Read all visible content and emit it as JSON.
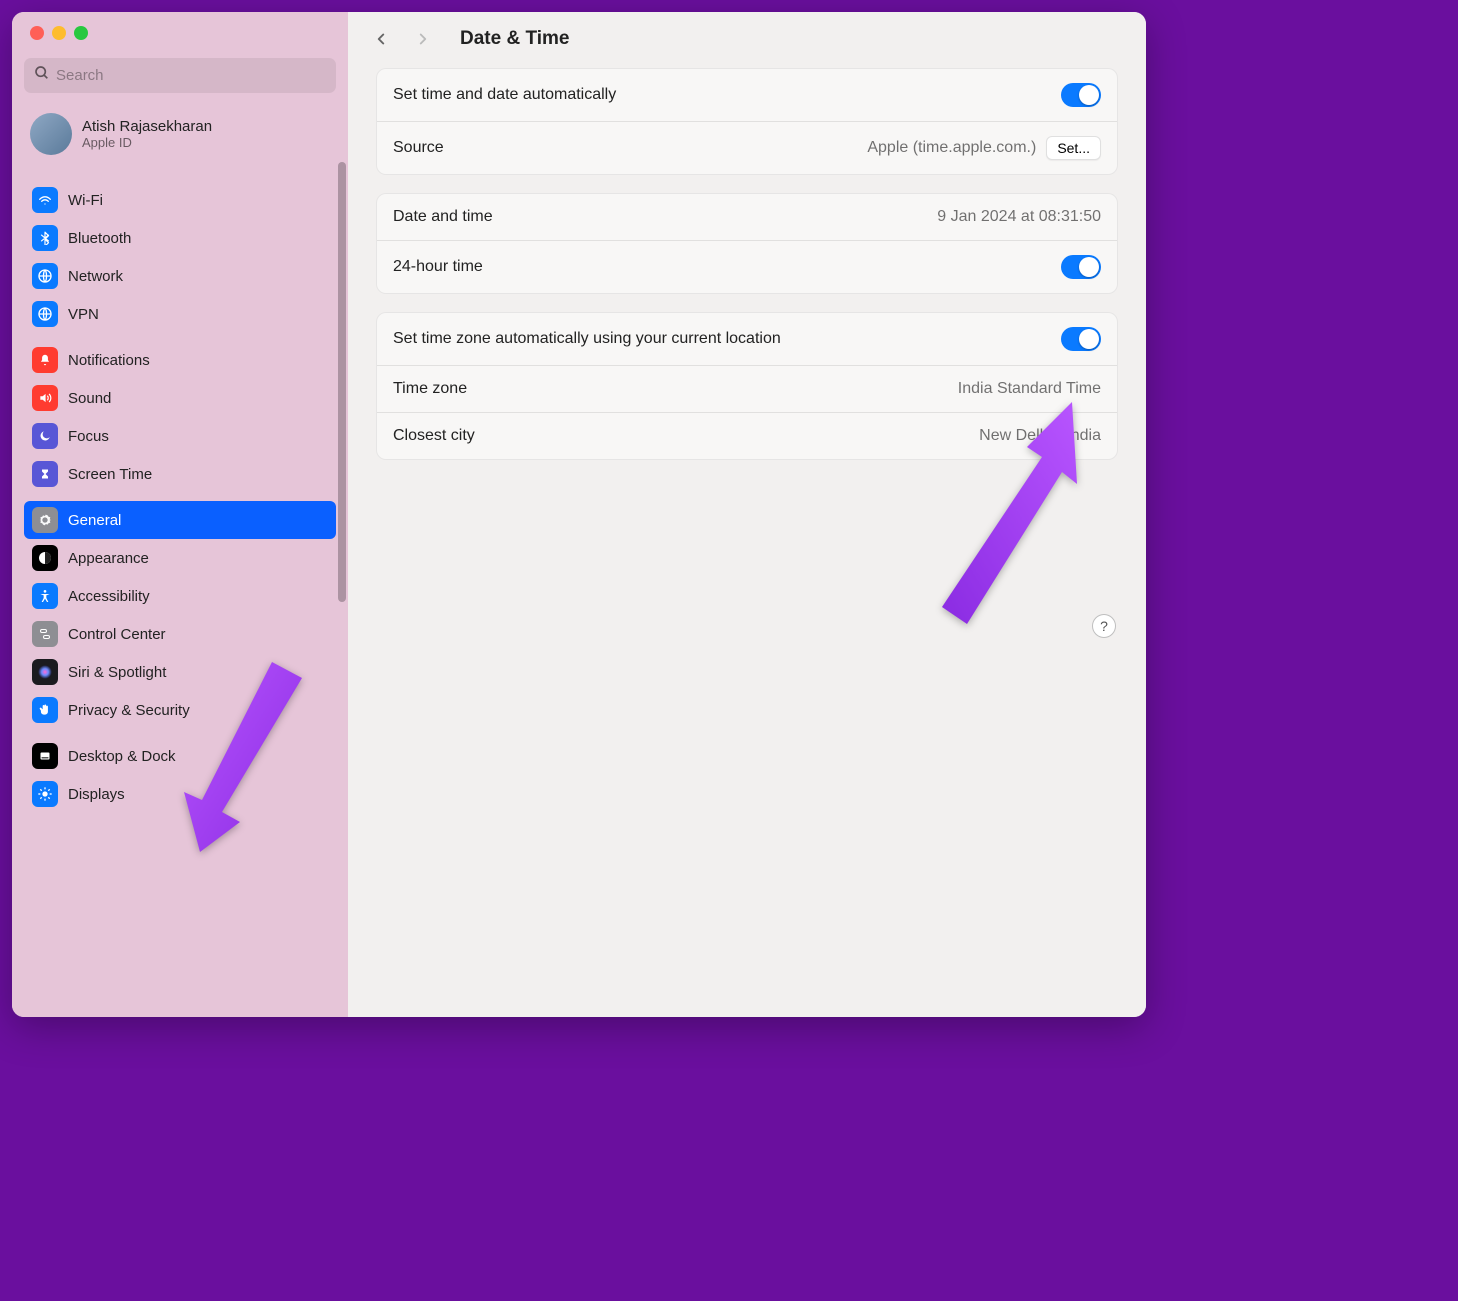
{
  "search": {
    "placeholder": "Search"
  },
  "profile": {
    "name": "Atish Rajasekharan",
    "sub": "Apple ID"
  },
  "sidebar": {
    "groups": [
      [
        {
          "label": "Wi-Fi",
          "icon": "wifi",
          "bg": "#0a7aff"
        },
        {
          "label": "Bluetooth",
          "icon": "bluetooth",
          "bg": "#0a7aff"
        },
        {
          "label": "Network",
          "icon": "globe",
          "bg": "#0a7aff"
        },
        {
          "label": "VPN",
          "icon": "globe",
          "bg": "#0a7aff"
        }
      ],
      [
        {
          "label": "Notifications",
          "icon": "bell",
          "bg": "#ff3b30"
        },
        {
          "label": "Sound",
          "icon": "speaker",
          "bg": "#ff3b30"
        },
        {
          "label": "Focus",
          "icon": "moon",
          "bg": "#5856d6"
        },
        {
          "label": "Screen Time",
          "icon": "hourglass",
          "bg": "#5856d6"
        }
      ],
      [
        {
          "label": "General",
          "icon": "gear",
          "bg": "#8e8e93",
          "selected": true
        },
        {
          "label": "Appearance",
          "icon": "appearance",
          "bg": "#000"
        },
        {
          "label": "Accessibility",
          "icon": "accessibility",
          "bg": "#0a7aff"
        },
        {
          "label": "Control Center",
          "icon": "switches",
          "bg": "#8e8e93"
        },
        {
          "label": "Siri & Spotlight",
          "icon": "siri",
          "bg": "#1b1b1f"
        },
        {
          "label": "Privacy & Security",
          "icon": "hand",
          "bg": "#0a7aff"
        }
      ],
      [
        {
          "label": "Desktop & Dock",
          "icon": "dock",
          "bg": "#000"
        },
        {
          "label": "Displays",
          "icon": "brightness",
          "bg": "#0a7aff"
        }
      ]
    ]
  },
  "header": {
    "title": "Date & Time"
  },
  "panels": [
    {
      "rows": [
        {
          "label": "Set time and date automatically",
          "toggle": true
        },
        {
          "label": "Source",
          "value": "Apple (time.apple.com.)",
          "button": "Set..."
        }
      ]
    },
    {
      "rows": [
        {
          "label": "Date and time",
          "value": "9 Jan 2024 at 08:31:50"
        },
        {
          "label": "24-hour time",
          "toggle": true
        }
      ]
    },
    {
      "rows": [
        {
          "label": "Set time zone automatically using your current location",
          "toggle": true
        },
        {
          "label": "Time zone",
          "value": "India Standard Time"
        },
        {
          "label": "Closest city",
          "value": "New Delhi - India"
        }
      ]
    }
  ],
  "help": "?"
}
